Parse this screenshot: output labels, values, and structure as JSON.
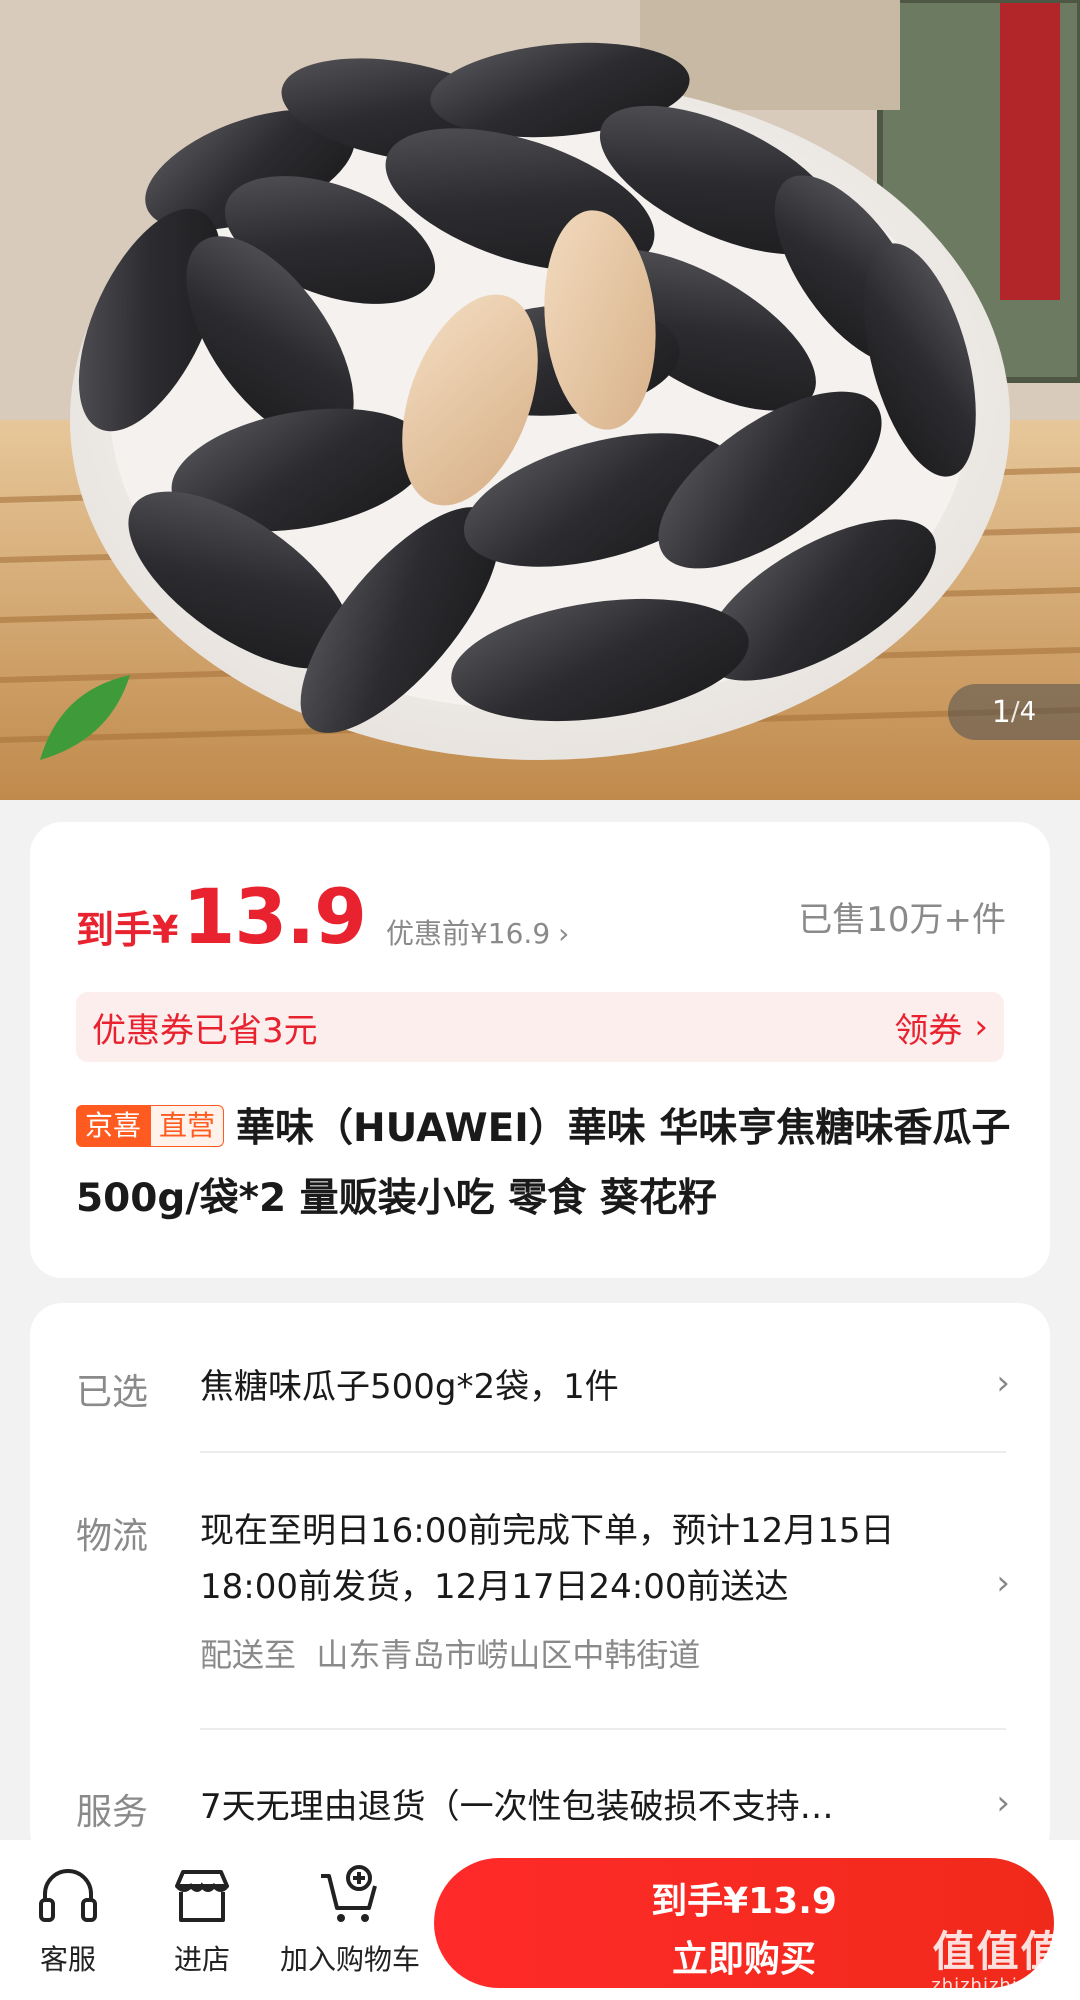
{
  "gallery": {
    "current": "1",
    "separator": "/",
    "total": "4"
  },
  "price": {
    "prefix": "到手¥",
    "value": "13.9",
    "before": "优惠前¥16.9",
    "sold": "已售10万+件"
  },
  "coupon": {
    "text": "优惠券已省3元",
    "action": "领券"
  },
  "product": {
    "tag_1": "京喜",
    "tag_2": "直营",
    "title": "華味（HUAWEI）華味 华味亨焦糖味香瓜子500g/袋*2 量贩装小吃 零食 葵花籽"
  },
  "info": {
    "selected_label": "已选",
    "selected_value": "焦糖味瓜子500g*2袋，1件",
    "logistics_label": "物流",
    "logistics_value": "现在至明日16:00前完成下单，预计12月15日18:00前发货，12月17日24:00前送达",
    "ship_to_label": "配送至",
    "ship_to_value": "山东青岛市崂山区中韩街道",
    "service_label": "服务",
    "service_value": "7天无理由退货（一次性包装破损不支持…"
  },
  "bottom": {
    "service": "客服",
    "store": "进店",
    "cart": "加入购物车",
    "buy_price": "到手¥13.9",
    "buy_label": "立即购买"
  },
  "watermark": {
    "main": "值值值",
    "sub": "zhizhizhi.com"
  },
  "colors": {
    "accent": "#e8222e",
    "tag": "#ff5a1f",
    "coupon_bg": "#fdeeee"
  },
  "icons": {
    "service": "headset-icon",
    "store": "storefront-icon",
    "cart": "cart-plus-icon",
    "chevron": "chevron-right-icon"
  }
}
